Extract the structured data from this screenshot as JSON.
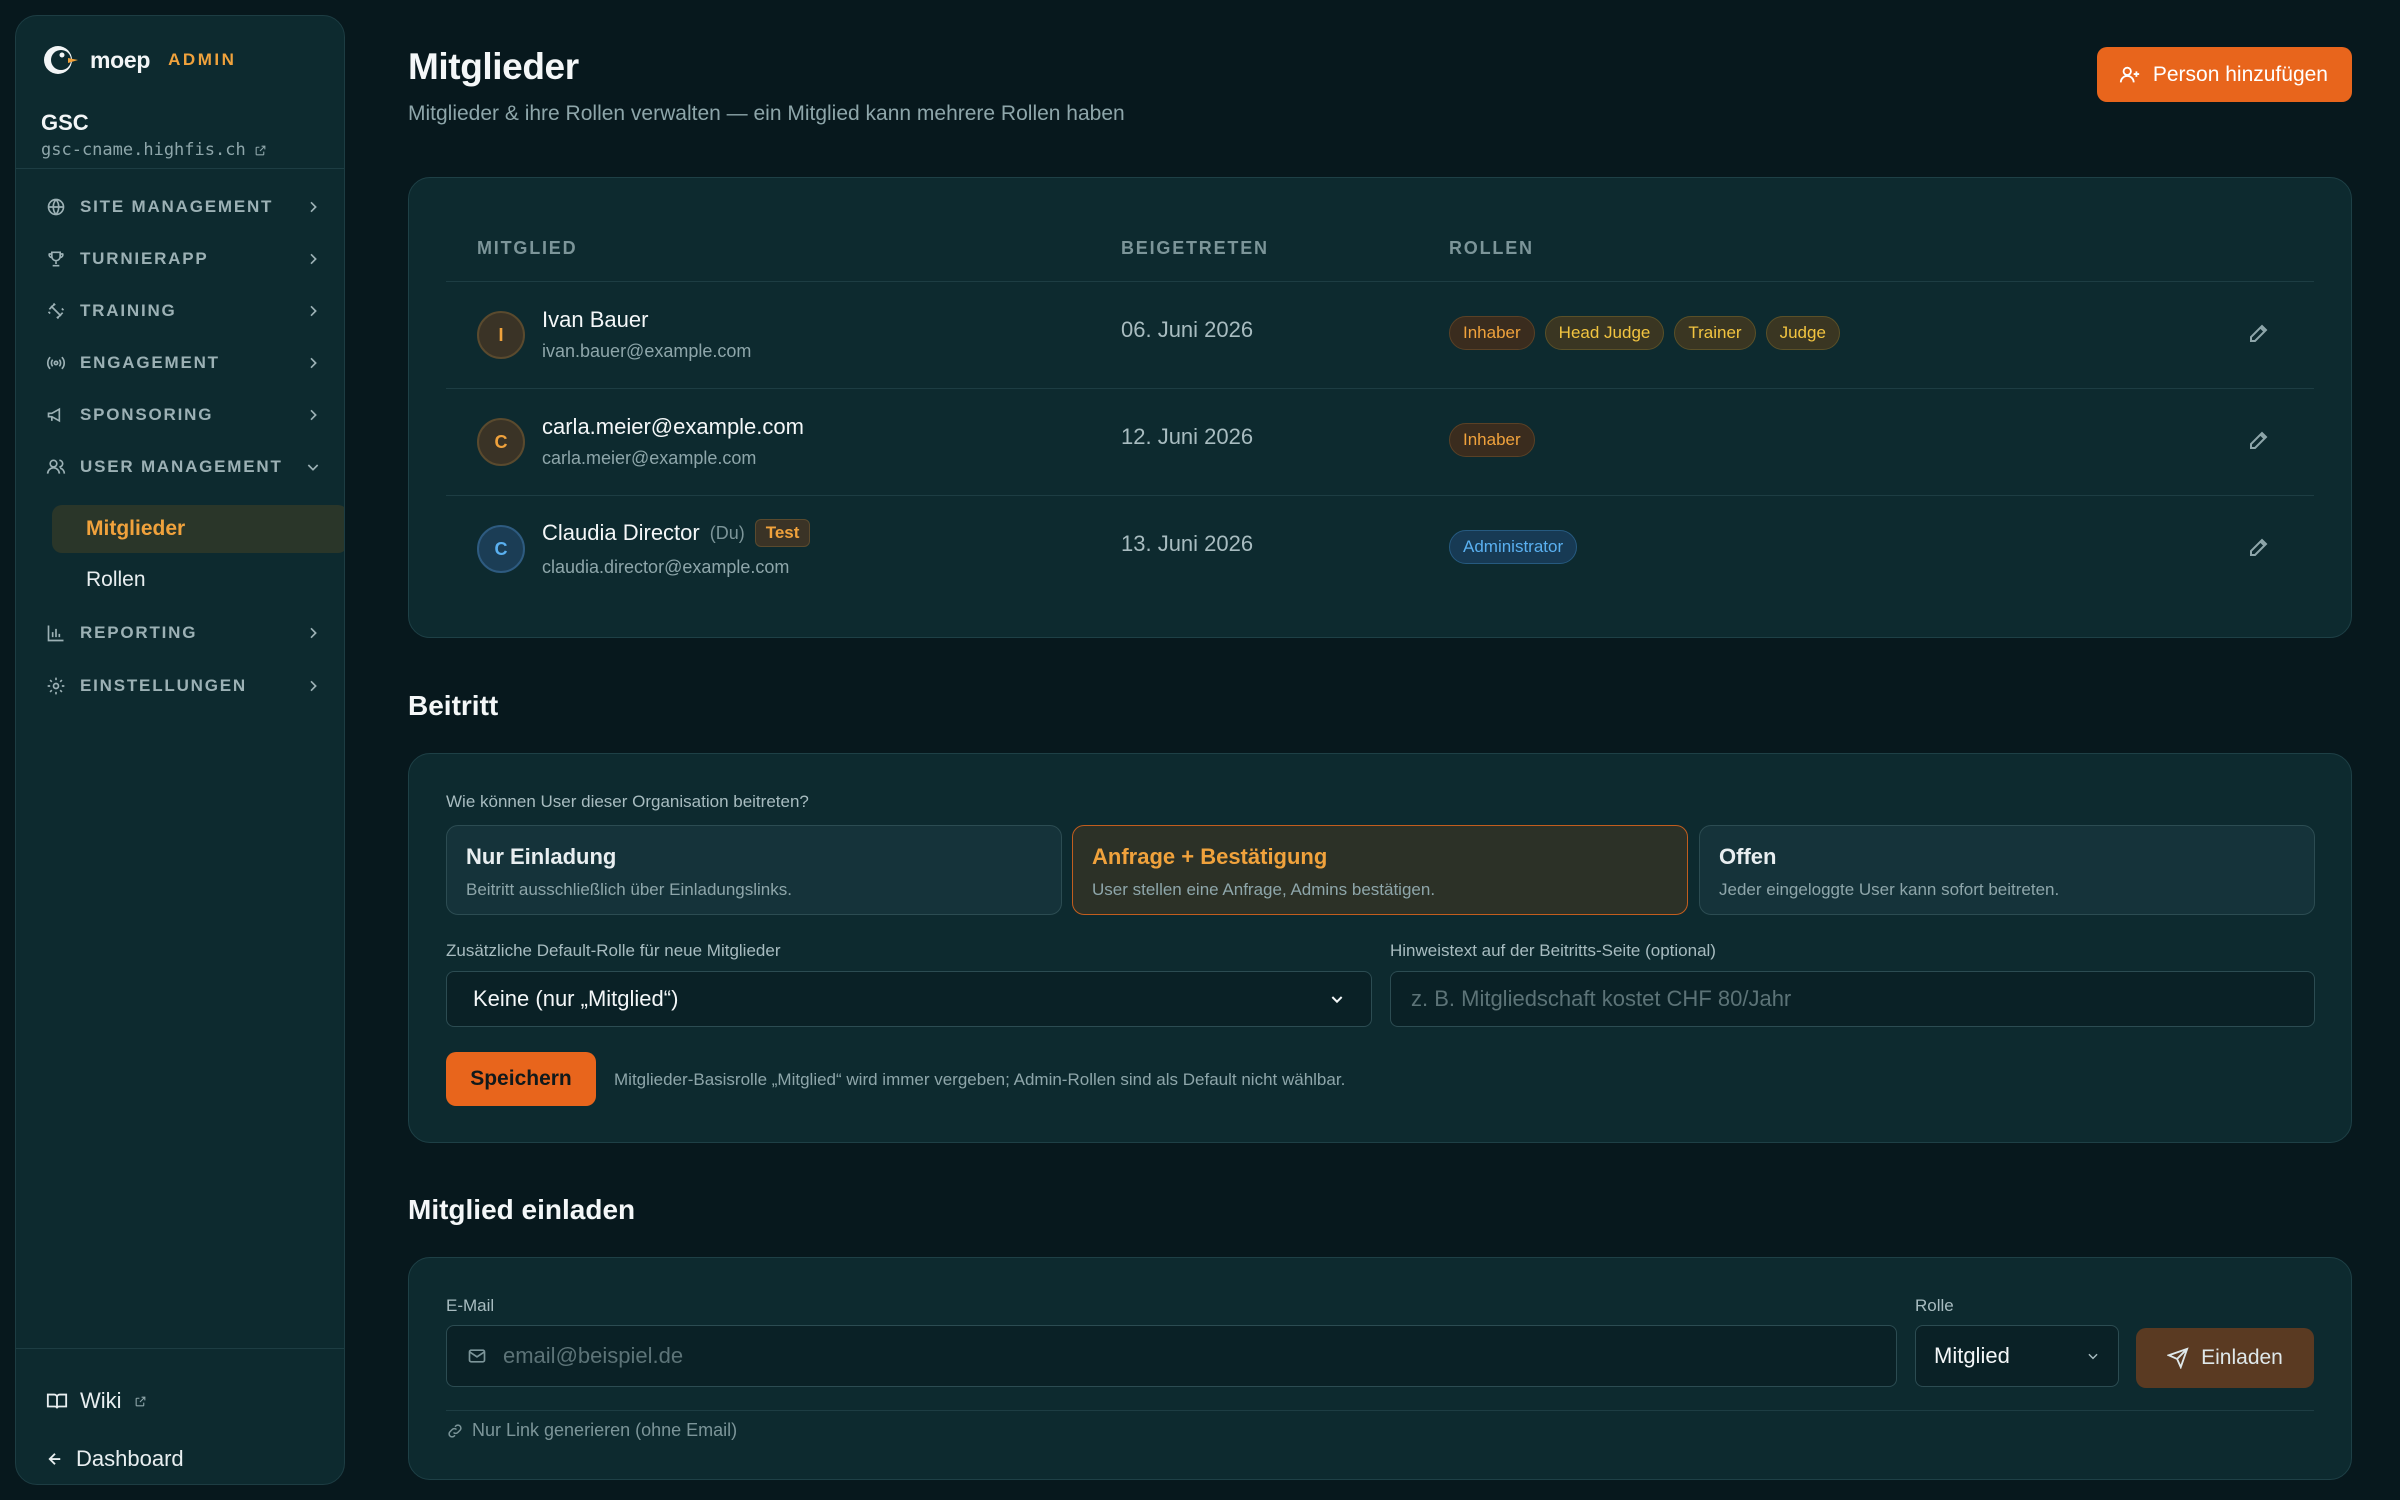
{
  "brand": {
    "name": "moep",
    "tag": "ADMIN"
  },
  "org": {
    "name": "GSC",
    "domain": "gsc-cname.highfis.ch"
  },
  "nav": {
    "site_management": "SITE MANAGEMENT",
    "turnierapp": "TURNIERAPP",
    "training": "TRAINING",
    "engagement": "ENGAGEMENT",
    "sponsoring": "SPONSORING",
    "user_management": "USER MANAGEMENT",
    "mitglieder": "Mitglieder",
    "rollen": "Rollen",
    "reporting": "REPORTING",
    "einstellungen": "EINSTELLUNGEN",
    "wiki": "Wiki",
    "dashboard": "Dashboard"
  },
  "page": {
    "title": "Mitglieder",
    "subtitle": "Mitglieder & ihre Rollen verwalten — ein Mitglied kann mehrere Rollen haben",
    "add_button": "Person hinzufügen"
  },
  "table": {
    "headers": {
      "member": "MITGLIED",
      "joined": "BEIGETRETEN",
      "roles": "ROLLEN"
    },
    "rows": [
      {
        "initial": "I",
        "name": "Ivan Bauer",
        "email": "ivan.bauer@example.com",
        "joined": "06. Juni 2026",
        "roles": [
          "Inhaber",
          "Head Judge",
          "Trainer",
          "Judge"
        ]
      },
      {
        "initial": "C",
        "name": "carla.meier@example.com",
        "email": "carla.meier@example.com",
        "joined": "12. Juni 2026",
        "roles": [
          "Inhaber"
        ]
      },
      {
        "initial": "C",
        "name": "Claudia Director",
        "du": "(Du)",
        "badge": "Test",
        "email": "claudia.director@example.com",
        "joined": "13. Juni 2026",
        "roles": [
          "Administrator"
        ]
      }
    ]
  },
  "join": {
    "section_title": "Beitritt",
    "question": "Wie können User dieser Organisation beitreten?",
    "options": [
      {
        "title": "Nur Einladung",
        "desc": "Beitritt ausschließlich über Einladungslinks."
      },
      {
        "title": "Anfrage + Bestätigung",
        "desc": "User stellen eine Anfrage, Admins bestätigen."
      },
      {
        "title": "Offen",
        "desc": "Jeder eingeloggte User kann sofort beitreten."
      }
    ],
    "default_role_label": "Zusätzliche Default-Rolle für neue Mitglieder",
    "default_role_value": "Keine (nur „Mitglied“)",
    "hint_label": "Hinweistext auf der Beitritts-Seite (optional)",
    "hint_placeholder": "z. B. Mitgliedschaft kostet CHF 80/Jahr",
    "save_button": "Speichern",
    "save_hint": "Mitglieder-Basisrolle „Mitglied“ wird immer vergeben; Admin-Rollen sind als Default nicht wählbar."
  },
  "invite": {
    "section_title": "Mitglied einladen",
    "email_label": "E-Mail",
    "email_placeholder": "email@beispiel.de",
    "role_label": "Rolle",
    "role_value": "Mitglied",
    "invite_button": "Einladen",
    "link_only": "Nur Link generieren (ohne Email)"
  },
  "colors": {
    "accent": "#e8651c",
    "accent_text": "#f0a23c",
    "background": "#07181d",
    "card": "#0d2a2f"
  }
}
